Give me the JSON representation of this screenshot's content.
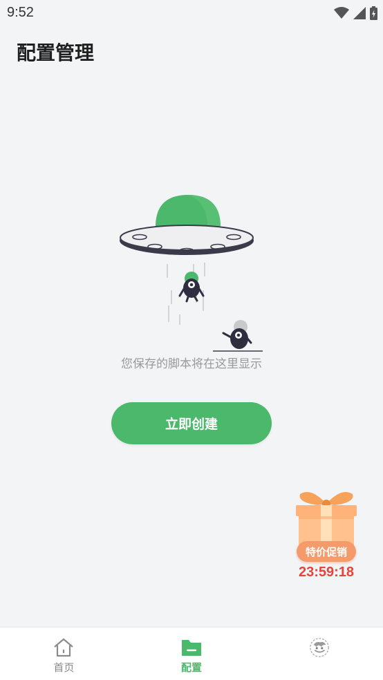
{
  "status_bar": {
    "time": "9:52"
  },
  "header": {
    "title": "配置管理"
  },
  "empty_state": {
    "message": "您保存的脚本将在这里显示",
    "button_label": "立即创建"
  },
  "promo": {
    "badge": "特价促销",
    "countdown": "23:59:18"
  },
  "bottom_nav": {
    "items": [
      {
        "label": "首页",
        "icon": "home-icon",
        "active": false
      },
      {
        "label": "配置",
        "icon": "folder-icon",
        "active": true
      },
      {
        "label": "",
        "icon": "avatar-icon",
        "active": false
      }
    ]
  },
  "colors": {
    "accent": "#4cb86b",
    "background": "#f3f4f6",
    "promo_badge": "#f59a6b",
    "countdown": "#e8423c"
  }
}
